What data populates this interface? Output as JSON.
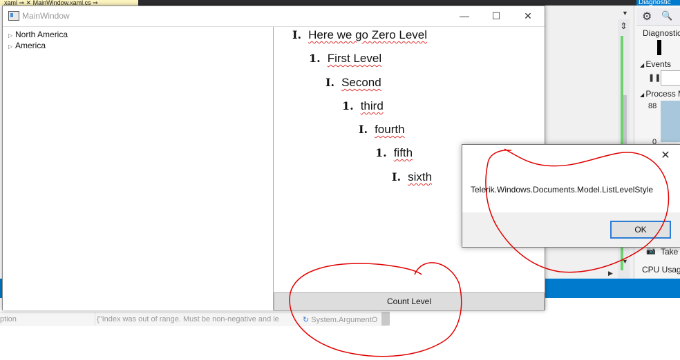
{
  "vs": {
    "tab_label": "xaml   ⇒ ✕   MainWindow.xaml.cs   ⇒",
    "diagnostics_title": "Diagnostic",
    "diagnostics_label": "Diagnostic",
    "events_label": "Events",
    "process_label": "Process M",
    "graph_max": "88",
    "graph_min": "0",
    "take_label": "Take",
    "cpu_label": "CPU Usage",
    "grid_col1": "ption",
    "grid_col2": "{\"Index was out of range. Must be non-negative and le",
    "grid_col3": "System.ArgumentO"
  },
  "window": {
    "title": "MainWindow",
    "minimize_glyph": "—",
    "maximize_glyph": "☐",
    "close_glyph": "✕"
  },
  "tree": {
    "items": [
      {
        "label": "North America"
      },
      {
        "label": "America"
      }
    ]
  },
  "document": {
    "list": [
      {
        "num": "I.",
        "text": "Here we go Zero Level"
      },
      {
        "num": "1.",
        "text": "First Level"
      },
      {
        "num": "I.",
        "text": "Second"
      },
      {
        "num": "1.",
        "text": "third"
      },
      {
        "num": "I.",
        "text": "fourth"
      },
      {
        "num": "1.",
        "text": "fifth"
      },
      {
        "num": "I.",
        "text": "sixth"
      }
    ]
  },
  "count_button": {
    "label": "Count Level"
  },
  "message_box": {
    "text": "Telerik.Windows.Documents.Model.ListLevelStyle",
    "ok_label": "OK",
    "close_glyph": "✕"
  },
  "annotation_color": "#e00000"
}
